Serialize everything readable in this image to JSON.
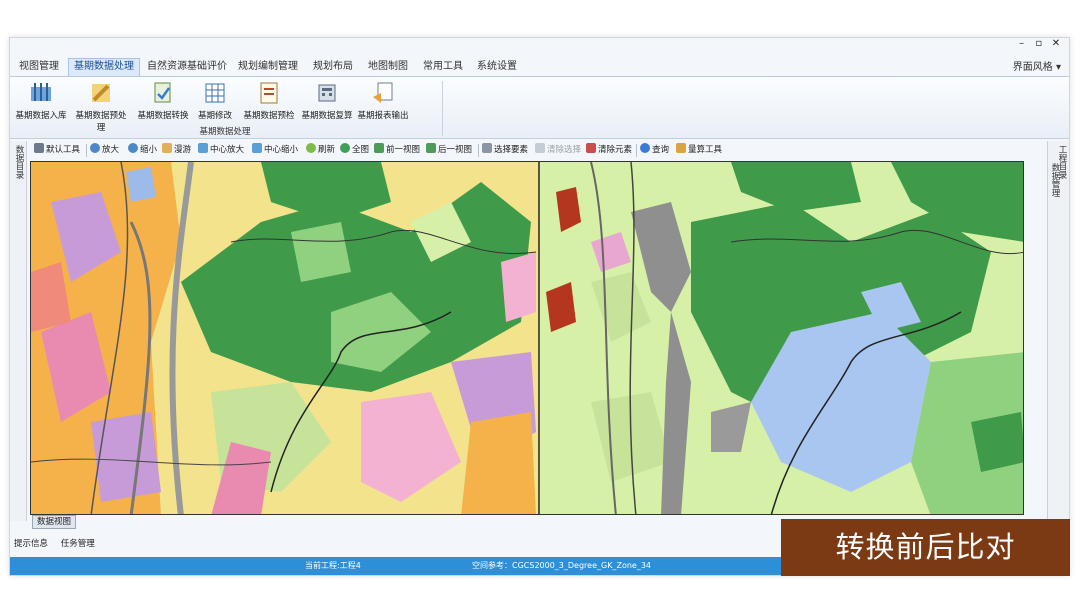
{
  "menu": {
    "tabs": [
      {
        "label": "视图管理"
      },
      {
        "label": "基期数据处理"
      },
      {
        "label": "自然资源基础评价"
      },
      {
        "label": "规划编制管理"
      },
      {
        "label": "规划布局"
      },
      {
        "label": "地图制图"
      },
      {
        "label": "常用工具"
      },
      {
        "label": "系统设置"
      }
    ],
    "active_index": 1,
    "style_label": "界面风格",
    "window_controls": [
      "–",
      "▫",
      "✕"
    ]
  },
  "ribbon": {
    "buttons": [
      {
        "label": "基期数据入库",
        "icon": "import-data-icon"
      },
      {
        "label": "基期数据预处理",
        "icon": "pencil-icon"
      },
      {
        "label": "基期数据转换",
        "icon": "convert-icon"
      },
      {
        "label": "基期修改",
        "icon": "grid-table-icon"
      },
      {
        "label": "基期数据预检",
        "icon": "checklist-icon"
      },
      {
        "label": "基期数据复算",
        "icon": "calculate-icon"
      },
      {
        "label": "基期报表输出",
        "icon": "report-output-icon"
      }
    ],
    "group_label": "基期数据处理"
  },
  "toolbar": {
    "items": [
      {
        "label": "默认工具",
        "icon": "pointer-icon",
        "disabled": false
      },
      {
        "label": "放大",
        "icon": "zoom-in-icon",
        "disabled": false
      },
      {
        "label": "缩小",
        "icon": "zoom-out-icon",
        "disabled": false
      },
      {
        "label": "漫游",
        "icon": "pan-hand-icon",
        "disabled": false
      },
      {
        "label": "中心放大",
        "icon": "center-zoom-in-icon",
        "disabled": false
      },
      {
        "label": "中心缩小",
        "icon": "center-zoom-out-icon",
        "disabled": false
      },
      {
        "label": "刷新",
        "icon": "refresh-icon",
        "disabled": false
      },
      {
        "label": "全图",
        "icon": "globe-icon",
        "disabled": false
      },
      {
        "label": "前一视图",
        "icon": "previous-view-icon",
        "disabled": false
      },
      {
        "label": "后一视图",
        "icon": "next-view-icon",
        "disabled": false
      },
      {
        "label": "选择要素",
        "icon": "select-feature-icon",
        "disabled": false
      },
      {
        "label": "清除选择",
        "icon": "clear-selection-icon",
        "disabled": true
      },
      {
        "label": "清除元素",
        "icon": "clear-element-icon",
        "disabled": false
      },
      {
        "label": "查询",
        "icon": "query-icon",
        "disabled": false
      },
      {
        "label": "量算工具",
        "icon": "measure-icon",
        "disabled": false
      }
    ]
  },
  "docks": {
    "left_label": "数据目录",
    "right_label_top": "工程目录",
    "right_label_bottom": "数据管理"
  },
  "view_tab": "数据视图",
  "bottom_tabs": [
    "提示信息",
    "任务管理"
  ],
  "status": {
    "project": "当前工程:工程4",
    "spatial_ref": "空间参考：CGCS2000_3_Degree_GK_Zone_34"
  },
  "overlay_caption": "转换前后比对",
  "colors": {
    "status_bar": "#2d8fd8",
    "overlay": "#7b3a14",
    "forest_dark": "#3f9a4a",
    "forest_light": "#8fd17e",
    "farmland_yellow": "#f2e38c",
    "construction_orange": "#f5b24a",
    "water_blue": "#a9c6f0",
    "purple_land": "#c79ad8",
    "grassland_pale": "#d6f0a8"
  }
}
